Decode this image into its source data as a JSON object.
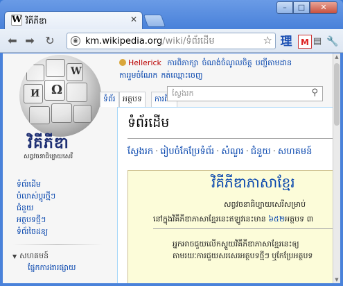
{
  "browser": {
    "tab_title": "វិគីភីឌា",
    "tab_favicon": "W",
    "url_host": "km.wikipedia.org",
    "url_path": "/wiki/ទំព័រដើម",
    "extensions": [
      "ri-icon",
      "gmail-icon",
      "page-icon",
      "wrench-icon"
    ],
    "ext_ri_glyph": "理",
    "ext_gmail_glyph": "M"
  },
  "logo": {
    "wordmark": "វិគីភីឌា",
    "tagline": "សព្វវចនាធិប្បាយសេរី"
  },
  "personal": {
    "username": "Hellerick",
    "links_row1": [
      "ការពិភាក្សា",
      "ចំណង់ចំណូលចិត្ត",
      "បញ្ជីតាមដាន"
    ],
    "links_row2": [
      "ការរួមចំណែក",
      "កត់ឈ្មោះចេញ"
    ]
  },
  "tabs": {
    "page_tab_left": "ទំព័រ",
    "article": "អត្ថបទ",
    "discussion": "ការពិ"
  },
  "search": {
    "placeholder": "ស្វែងរក"
  },
  "content": {
    "first_heading": "ទំព័រដើម",
    "topnav": [
      "ស្វែងរក",
      "រៀបចំកែប្រែទំព័រ",
      "សំណួរ",
      "ជំនួយ",
      "សហគមន៍"
    ],
    "welcome_title": "វិគីភីឌាភាសាខ្មែរ",
    "welcome_sub": "សព្វវចនាធិប្បាយសេរីសម្រាប់",
    "stats_prefix": "នៅក្នុងវិគីភីឌាភាសាខ្មែរនេះឥឡូវនេះមាន",
    "stats_number": "៦៥២",
    "stats_suffix": "អត្ថបទ ៣",
    "para_line1": "អ្នកអាចជួយលើកស្ទួយវិគីភីឌាភាសាខ្មែរនេះឲ្យ",
    "para_line2": "តាមរយៈការជួយសរសេរអត្ថបទថ្មីៗ ឬកែប្រែអត្ថបទ"
  },
  "sidebar": {
    "links": [
      "ទំព័រដើម",
      "បំលាស់ប្តូរថ្មីៗ",
      "ជំនួយ",
      "អត្ថបទថ្មីៗ",
      "ទំព័រចៃដន្យ"
    ],
    "portal_heading": "សហគមន៍",
    "portal_first_item": "ផ្នែកការងារផ្សាយ"
  }
}
